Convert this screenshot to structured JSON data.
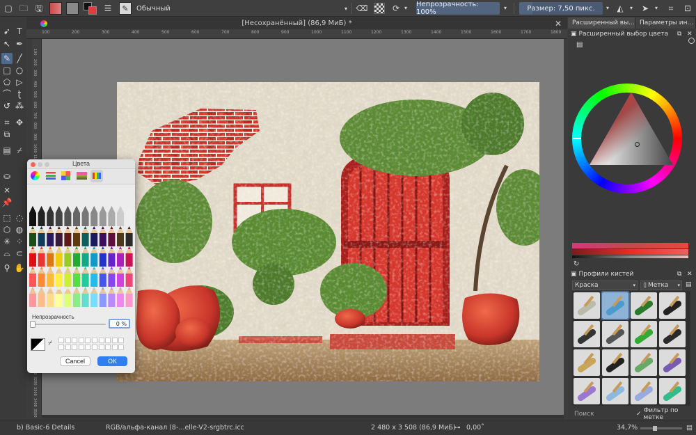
{
  "topbar": {
    "blend_mode": "Обычный",
    "opacity_label": "Непрозрачность: 100%",
    "size_label": "Размер: 7,50 пикс."
  },
  "document": {
    "title": "[Несохранённый]  (86,9 МиБ) *"
  },
  "ruler_ticks": [
    "100",
    "200",
    "300",
    "400",
    "500",
    "600",
    "700",
    "800",
    "900",
    "1000",
    "1100",
    "1200",
    "1300",
    "1400",
    "1500",
    "1600",
    "1700",
    "1800"
  ],
  "ruler_left_ticks": [
    "100",
    "200",
    "300",
    "400",
    "500",
    "600",
    "700",
    "800",
    "900",
    "1000",
    "1100",
    "1200",
    "1300",
    "1400",
    "1500",
    "1600",
    "1700",
    "1800",
    "1900",
    "2000",
    "2100",
    "2200",
    "2300",
    "2400",
    "2500",
    "2600",
    "2700",
    "2800",
    "2900",
    "3000",
    "3100",
    "3200",
    "3300",
    "3400",
    "3500"
  ],
  "right_dock": {
    "tab1": "Расширенный вы...",
    "tab2": "Параметры ин...",
    "color_panel_title": "Расширенный выбор цвета",
    "brush_panel_title": "Профили кистей",
    "brush_preset_dropdown": "Краска",
    "tag_button": "Метка",
    "search_placeholder": "Поиск",
    "filter_by_tag": "Фильтр по метке"
  },
  "statusbar": {
    "brush_name": "b) Basic-6 Details",
    "color_profile": "RGB/альфа-канал (8-...elle-V2-srgbtrc.icc",
    "dimensions": "2 480 x 3 508 (86,9 МиБ)",
    "rotation": "0,00˚",
    "zoom": "34,7%"
  },
  "color_dialog": {
    "title": "Цвета",
    "opacity_label": "Непрозрачность",
    "opacity_value": "0 %",
    "cancel_label": "Cancel",
    "ok_label": "OK"
  },
  "colors": {
    "accent": "#52647e",
    "selection": "#4d6b91",
    "dialog_ok": "#2f7ff0"
  }
}
